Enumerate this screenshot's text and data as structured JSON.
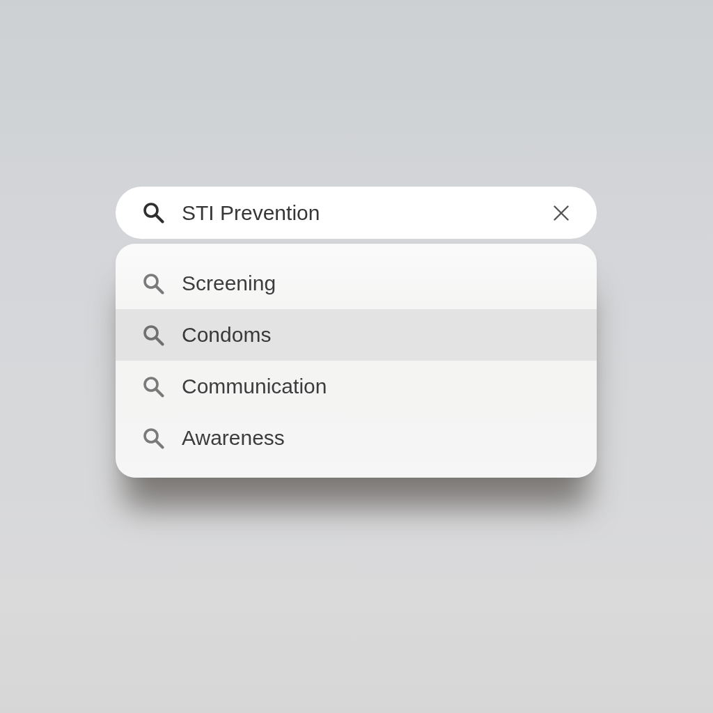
{
  "search": {
    "value": "STI Prevention"
  },
  "suggestions": [
    {
      "label": "Screening",
      "selected": false
    },
    {
      "label": "Condoms",
      "selected": true
    },
    {
      "label": "Communication",
      "selected": false
    },
    {
      "label": "Awareness",
      "selected": false
    }
  ]
}
